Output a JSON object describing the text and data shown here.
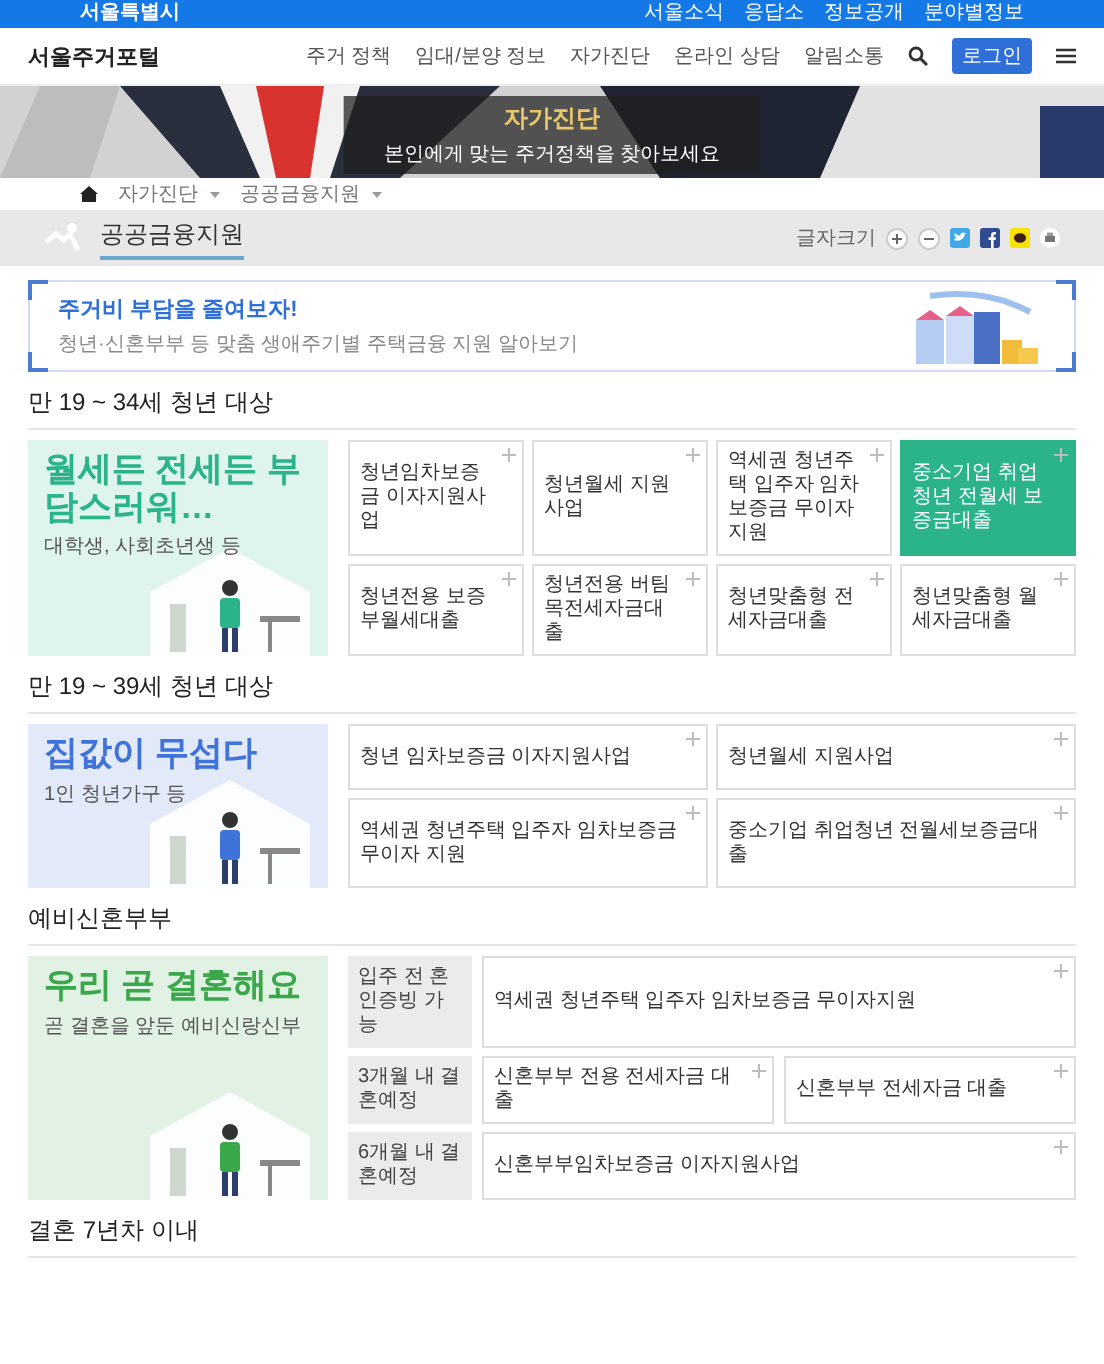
{
  "top_bar": {
    "logo": "서울특별시",
    "links": [
      "서울소식",
      "응답소",
      "정보공개",
      "분야별정보"
    ]
  },
  "nav": {
    "logo": "서울주거포털",
    "menu": [
      "주거 정책",
      "임대/분양 정보",
      "자가진단",
      "온라인 상담",
      "알림소통"
    ],
    "login": "로그인"
  },
  "hero": {
    "title": "자가진단",
    "subtitle": "본인에게 맞는 주거정책을 찾아보세요"
  },
  "breadcrumb": [
    "자가진단",
    "공공금융지원"
  ],
  "page_title": "공공금융지원",
  "font_size_label": "글자크기",
  "banner": {
    "title": "주거비 부담을 줄여보자!",
    "text": "청년·신혼부부 등 맞춤 생애주기별 주택금융 지원 알아보기"
  },
  "sections": [
    {
      "kind": "grid",
      "title": "만 19 ~ 34세 청년 대상",
      "color": "#2bb38a",
      "promo": {
        "title": "월세든 전세든 부담스러워…",
        "text": "대학생, 사회초년생 등"
      },
      "cards": [
        {
          "label": "청년임차보증금 이자지원사업",
          "selected": false
        },
        {
          "label": "청년월세 지원사업",
          "selected": false
        },
        {
          "label": "역세권 청년주택 입주자 임차보증금 무이자 지원",
          "selected": false
        },
        {
          "label": "중소기업 취업청년 전월세 보증금대출",
          "selected": true
        },
        {
          "label": "청년전용 보증부월세대출",
          "selected": false
        },
        {
          "label": "청년전용 버팀목전세자금대출",
          "selected": false
        },
        {
          "label": "청년맞춤형 전세자금대출",
          "selected": false
        },
        {
          "label": "청년맞춤형 월세자금대출",
          "selected": false
        }
      ]
    },
    {
      "kind": "grid",
      "title": "만 19 ~ 39세 청년 대상",
      "color": "#3f73d9",
      "promo": {
        "title": "집값이 무섭다",
        "text": "1인 청년가구 등"
      },
      "cards": [
        {
          "label": "청년 임차보증금 이자지원사업",
          "selected": false
        },
        {
          "label": "청년월세 지원사업",
          "selected": false
        },
        {
          "label": "역세권 청년주택 입주자 임차보증금 무이자 지원",
          "selected": false
        },
        {
          "label": "중소기업 취업청년 전월세보증금대출",
          "selected": false
        }
      ]
    },
    {
      "kind": "rows",
      "title": "예비신혼부부",
      "color": "#3aa84a",
      "promo": {
        "title": "우리 곧 결혼해요",
        "text": "곧 결혼을 앞둔 예비신랑신부"
      },
      "rows": [
        {
          "label": "입주 전 혼인증빙 가능",
          "cards": [
            {
              "label": "역세권 청년주택 입주자 임차보증금 무이자지원",
              "selected": false
            }
          ]
        },
        {
          "label": "3개월 내 결혼예정",
          "cards": [
            {
              "label": "신혼부부 전용 전세자금 대출",
              "selected": false
            },
            {
              "label": "신혼부부 전세자금 대출",
              "selected": false
            }
          ]
        },
        {
          "label": "6개월 내 결혼예정",
          "cards": [
            {
              "label": "신혼부부임차보증금 이자지원사업",
              "selected": false
            }
          ]
        }
      ]
    },
    {
      "kind": "heading",
      "title": "결혼 7년차 이내"
    }
  ]
}
